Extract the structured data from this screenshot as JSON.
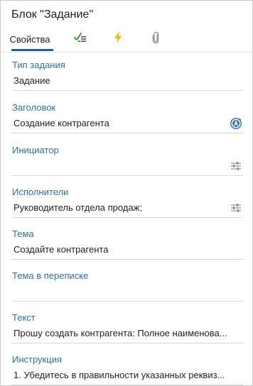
{
  "panel": {
    "title": "Блок \"Задание\""
  },
  "tabs": [
    {
      "label": "Свойства",
      "active": true
    },
    {
      "icon": "checklist-icon"
    },
    {
      "icon": "lightning-icon"
    },
    {
      "icon": "paperclip-icon"
    }
  ],
  "fields": {
    "task_type": {
      "label": "Тип задания",
      "value": "Задание"
    },
    "heading": {
      "label": "Заголовок",
      "value": "Создание контрагента",
      "icon": "expression-a-icon"
    },
    "initiator": {
      "label": "Инициатор",
      "value": "",
      "icon": "settings-sliders-icon"
    },
    "performers": {
      "label": "Исполнители",
      "value": "Руководитель отдела продаж;",
      "icon": "settings-sliders-icon"
    },
    "subject": {
      "label": "Тема",
      "value": "Создайте контрагента"
    },
    "thread_subject": {
      "label": "Тема в переписке",
      "value": ""
    },
    "text": {
      "label": "Текст",
      "value": "Прошу создать контрагента: Полное наименова..."
    },
    "instruction": {
      "label": "Инструкция",
      "value": "1. Убедитесь в правильности указанных реквиз..."
    }
  },
  "colors": {
    "accent": "#1f5f8a",
    "label": "#2e6fa7",
    "checklist_green": "#3a9a3a",
    "lightning_yellow": "#f2b705",
    "icon_gray": "#8a8a8a"
  }
}
